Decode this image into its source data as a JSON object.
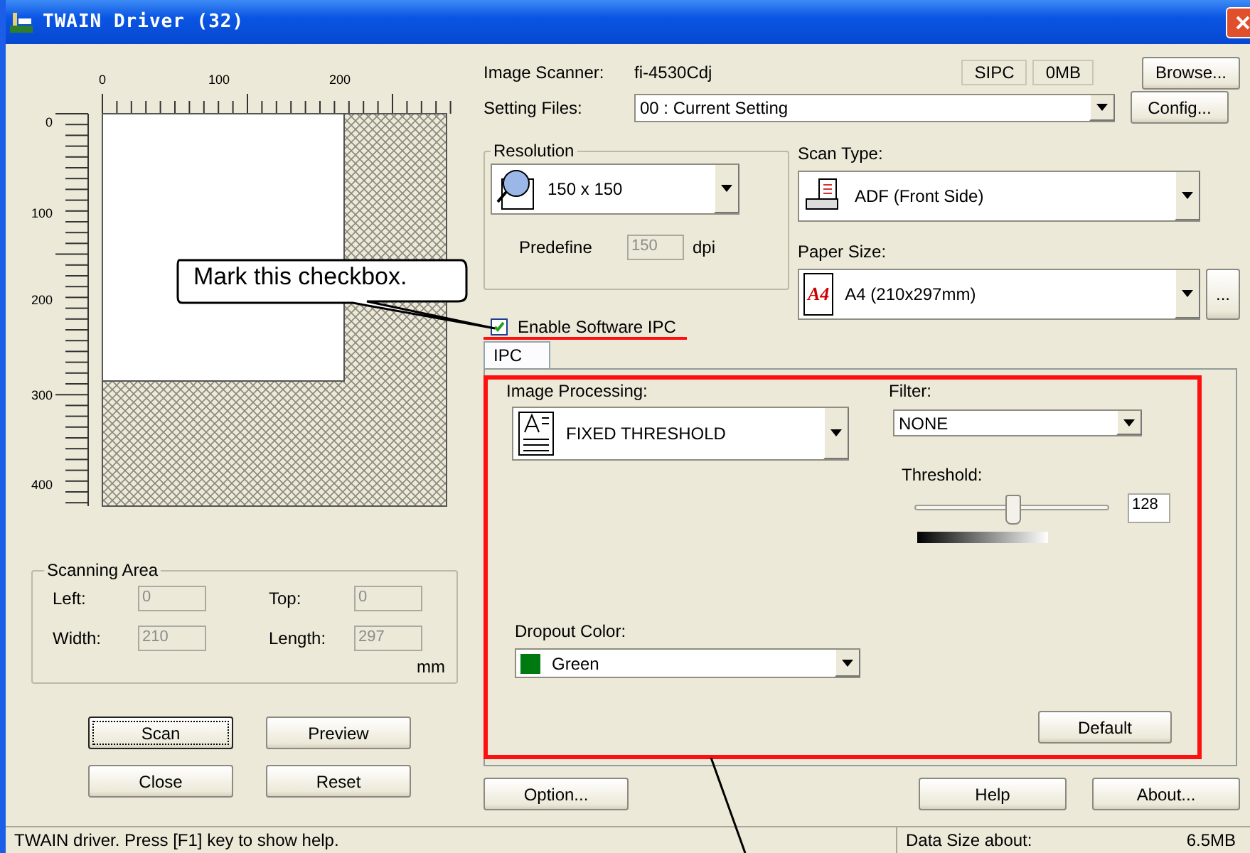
{
  "window": {
    "title": "TWAIN Driver (32)"
  },
  "preview": {
    "x_ruler": [
      "0",
      "100",
      "200"
    ],
    "y_ruler": [
      "0",
      "100",
      "200",
      "300",
      "400"
    ]
  },
  "scanning_area": {
    "title": "Scanning Area",
    "disabled": true,
    "unit": "mm",
    "fields": [
      {
        "label": "Left:",
        "value": "0"
      },
      {
        "label": "Top:",
        "value": "0"
      },
      {
        "label": "Width:",
        "value": "210"
      },
      {
        "label": "Length:",
        "value": "297"
      }
    ]
  },
  "left_buttons": [
    {
      "label": "Scan",
      "focused": true
    },
    {
      "label": "Preview",
      "focused": false
    },
    {
      "label": "Close",
      "focused": false
    },
    {
      "label": "Reset",
      "focused": false
    }
  ],
  "scanner": {
    "label": "Image Scanner:",
    "value": "fi-4530Cdj",
    "badges": [
      "SIPC",
      "0MB"
    ],
    "button": "Browse..."
  },
  "setting_files": {
    "label": "Setting Files:",
    "value": "00 : Current Setting",
    "button": "Config..."
  },
  "resolution": {
    "title": "Resolution",
    "value": "150 x 150",
    "predefine_label": "Predefine",
    "predefine_value": "150",
    "predefine_disabled": true,
    "unit": "dpi"
  },
  "scan_type": {
    "label": "Scan Type:",
    "value": "ADF (Front Side)"
  },
  "paper_size": {
    "label": "Paper Size:",
    "icon_text": "A4",
    "value": "A4 (210x297mm)",
    "more_button": "..."
  },
  "enable_ipc": {
    "label": "Enable Software IPC",
    "checked": true
  },
  "tabs": [
    {
      "label": "IPC",
      "selected": true
    }
  ],
  "ipc": {
    "image_processing": {
      "label": "Image Processing:",
      "value": "FIXED THRESHOLD"
    },
    "filter": {
      "label": "Filter:",
      "value": "NONE"
    },
    "threshold": {
      "label": "Threshold:",
      "level": 0.5,
      "value": "128"
    },
    "dropout": {
      "label": "Dropout Color:",
      "value": "Green"
    },
    "default_button": "Default"
  },
  "bottom_buttons": [
    "Option...",
    "Help",
    "About..."
  ],
  "status_bar": {
    "text": "TWAIN driver. Press [F1] key to show help.",
    "data_size_label": "Data Size about:",
    "data_size": "6.5MB"
  },
  "callout": {
    "text": "Mark this checkbox."
  }
}
